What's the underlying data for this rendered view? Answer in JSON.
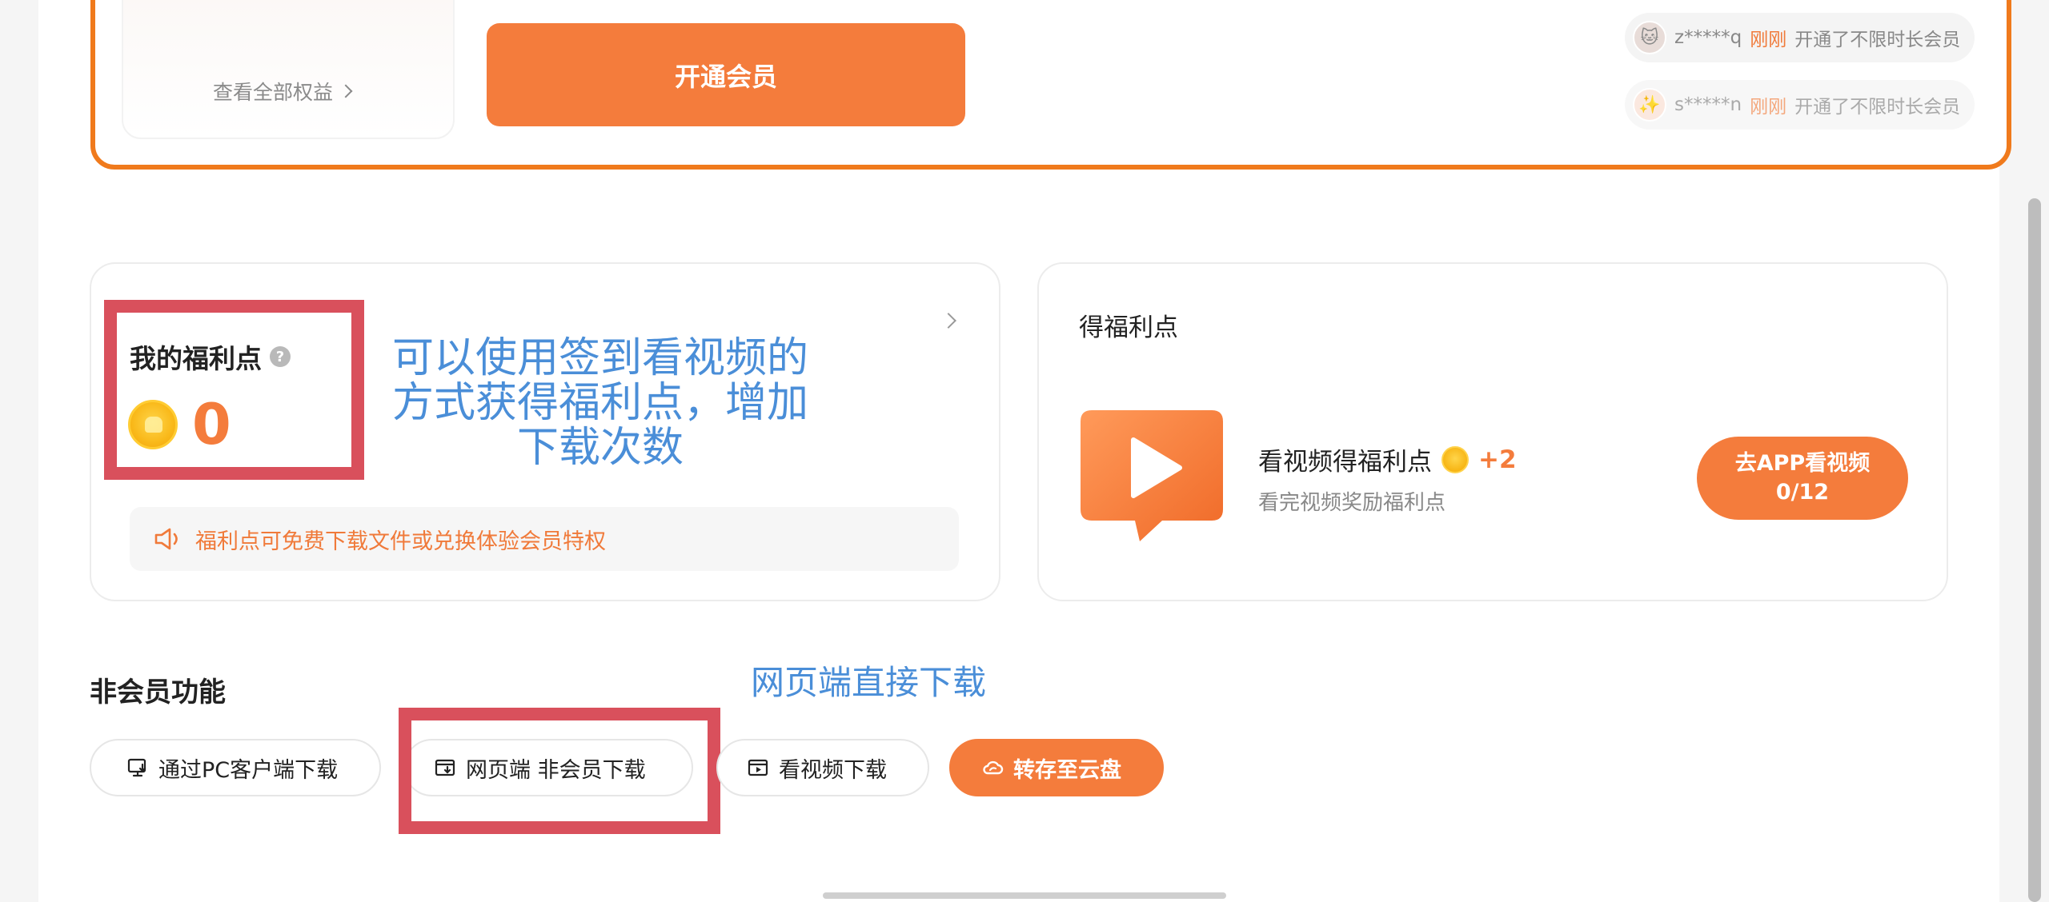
{
  "member": {
    "benefits_link": "查看全部权益",
    "open_button": "开通会员",
    "tickers": [
      {
        "user": "z*****q",
        "time": "刚刚",
        "action": "开通了不限时长会员"
      },
      {
        "user": "s*****n",
        "time": "刚刚",
        "action": "开通了不限时长会员"
      }
    ]
  },
  "welfare": {
    "title": "我的福利点",
    "help_icon": "question-icon",
    "points": "0",
    "notice": "福利点可免费下载文件或兑换体验会员特权"
  },
  "annotations": {
    "welfare_note": "可以使用签到看视频的方式获得福利点，增加下载次数",
    "web_note": "网页端直接下载"
  },
  "earn": {
    "title": "得福利点",
    "task_title": "看视频得福利点",
    "reward": "+2",
    "task_desc": "看完视频奖励福利点",
    "button_line1": "去APP看视频",
    "button_line2": "0/12"
  },
  "non_member": {
    "title": "非会员功能",
    "buttons": [
      {
        "label": "通过PC客户端下载",
        "icon": "desktop-download-icon"
      },
      {
        "label": "网页端 非会员下载",
        "icon": "browser-download-icon"
      },
      {
        "label": "看视频下载",
        "icon": "video-icon"
      },
      {
        "label": "转存至云盘",
        "icon": "cloud-icon"
      }
    ]
  },
  "colors": {
    "accent": "#f47c3c",
    "border_orange": "#f07a1c",
    "highlight_red": "#d9505c",
    "annotation_blue": "#4a8ed8"
  }
}
